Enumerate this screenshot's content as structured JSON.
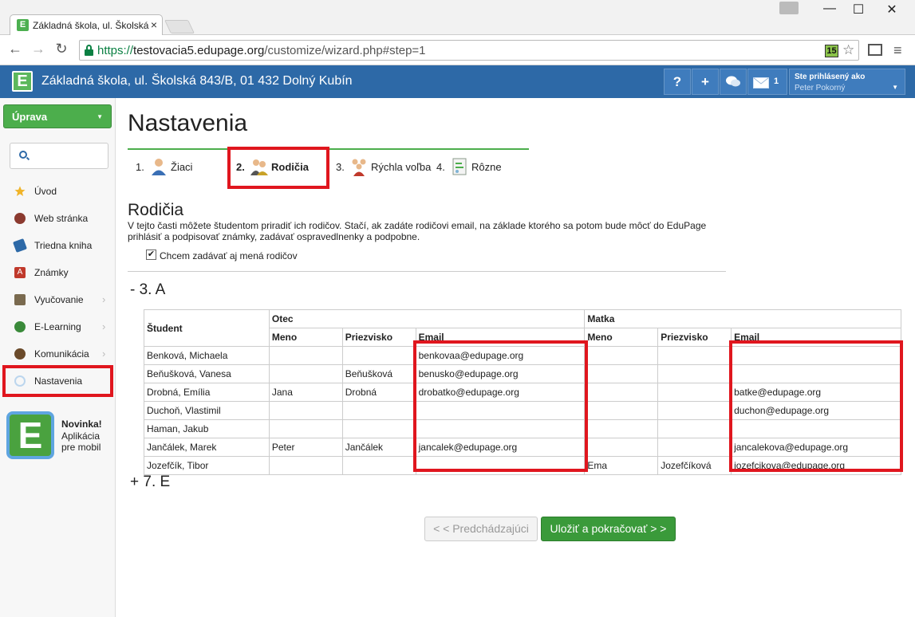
{
  "browser": {
    "tab_title": "Základná škola, ul. Školská",
    "tab_close": "×",
    "win_min": "—",
    "win_max": "☐",
    "win_close": "✕",
    "url_scheme": "https://",
    "url_host": "testovacia5.edupage.org",
    "url_path": "/customize/wizard.php#step=1",
    "ext_badge": "15"
  },
  "header": {
    "school_name": "Základná škola, ul. Školská 843/B, 01 432 Dolný Kubín",
    "help": "?",
    "add": "+",
    "messages_count": "1",
    "login_label": "Ste prihlásený ako",
    "login_user": "Peter Pokorný"
  },
  "sidebar": {
    "uprava_label": "Úprava",
    "items": [
      {
        "label": "Úvod",
        "color": "#f0b429"
      },
      {
        "label": "Web stránka",
        "color": "#8b3a2f"
      },
      {
        "label": "Triedna kniha",
        "color": "#2d69a7"
      },
      {
        "label": "Známky",
        "color": "#c0392b"
      },
      {
        "label": "Vyučovanie",
        "color": "#7a6a4f"
      },
      {
        "label": "E-Learning",
        "color": "#3a8a3a"
      },
      {
        "label": "Komunikácia",
        "color": "#6a4a2a"
      },
      {
        "label": "Nastavenia",
        "color": "#bcd6ee"
      }
    ],
    "promo_line1": "Novinka!",
    "promo_line2": "Aplikácia",
    "promo_line3": "pre mobil",
    "promo_logo": "E"
  },
  "main": {
    "title": "Nastavenia",
    "steps": [
      {
        "num": "1.",
        "label": "Žiaci"
      },
      {
        "num": "2.",
        "label": "Rodičia"
      },
      {
        "num": "3.",
        "label": "Rýchla voľba"
      },
      {
        "num": "4.",
        "label": "Rôzne"
      }
    ],
    "section_title": "Rodičia",
    "description": "V tejto časti môžete študentom priradiť ich rodičov. Stačí, ak zadáte rodičovi email, na základe ktorého sa potom bude môcť do EduPage prihlásiť a podpisovať známky, zadávať ospravedlnenky a podpobne.",
    "checkbox_label": "Chcem zadávať aj mená rodičov",
    "checkbox_checked": true,
    "group_a": "- 3. A",
    "group_e": "+ 7. E",
    "btn_prev": "< < Predchádzajúci",
    "btn_save": "Uložiť a pokračovať > >"
  },
  "table": {
    "h_student": "Študent",
    "h_father": "Otec",
    "h_mother": "Matka",
    "h_name": "Meno",
    "h_surname": "Priezvisko",
    "h_email": "Email",
    "rows": [
      [
        "Benková, Michaela",
        "",
        "",
        "benkovaa@edupage.org",
        "",
        "",
        ""
      ],
      [
        "Beňušková, Vanesa",
        "",
        "Beňušková",
        "benusko@edupage.org",
        "",
        "",
        ""
      ],
      [
        "Drobná, Emília",
        "Jana",
        "Drobná",
        "drobatko@edupage.org",
        "",
        "",
        "batke@edupage.org"
      ],
      [
        "Duchoň, Vlastimil",
        "",
        "",
        "",
        "",
        "",
        "duchon@edupage.org"
      ],
      [
        "Haman, Jakub",
        "",
        "",
        "",
        "",
        "",
        ""
      ],
      [
        "Jančálek, Marek",
        "Peter",
        "Jančálek",
        "jancalek@edupage.org",
        "",
        "",
        "jancalekova@edupage.org"
      ],
      [
        "Jozefčík, Tibor",
        "",
        "",
        "",
        "Ema",
        "Jozefčíková",
        "jozefcikova@edupage.org"
      ]
    ]
  },
  "colors": {
    "header_bg": "#2d69a7",
    "accent_green": "#4cae4c",
    "highlight_red": "#e0161e"
  }
}
